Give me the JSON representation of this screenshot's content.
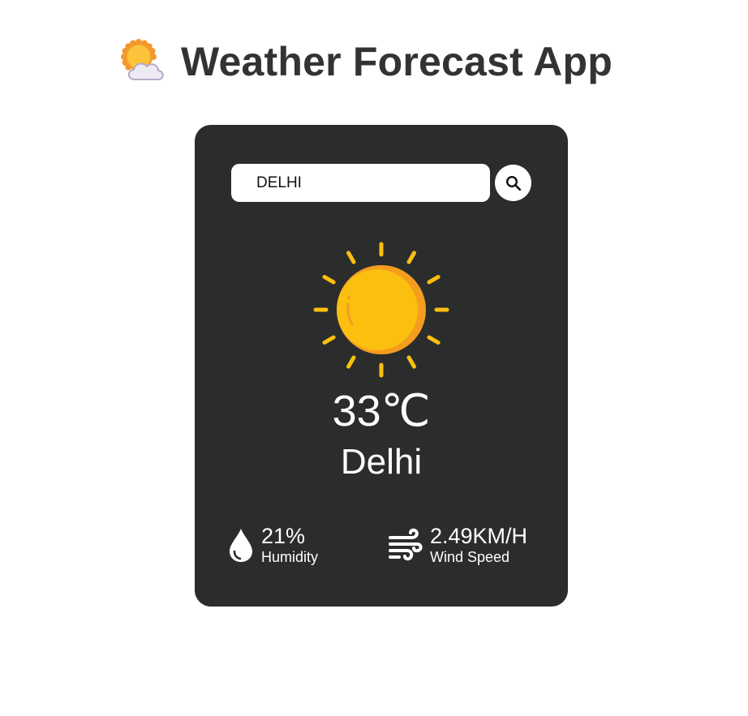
{
  "app": {
    "title": "Weather Forecast App",
    "logo_icon": "sun-behind-cloud-icon"
  },
  "search": {
    "value": "DELHI",
    "button_icon": "search-icon"
  },
  "weather": {
    "icon": "sun-icon",
    "temperature_value": "33",
    "temperature_unit": "℃",
    "city": "Delhi"
  },
  "details": {
    "humidity": {
      "icon": "water-drop-icon",
      "value": "21%",
      "label": "Humidity"
    },
    "wind": {
      "icon": "wind-icon",
      "value": "2.49KM/H",
      "label": "Wind Speed"
    }
  },
  "colors": {
    "card_background": "#2b2c2c",
    "title_text": "#333333",
    "sun_yellow": "#fbbf0f",
    "sun_shadow": "#f59d1f",
    "text_on_card": "#ffffff"
  }
}
